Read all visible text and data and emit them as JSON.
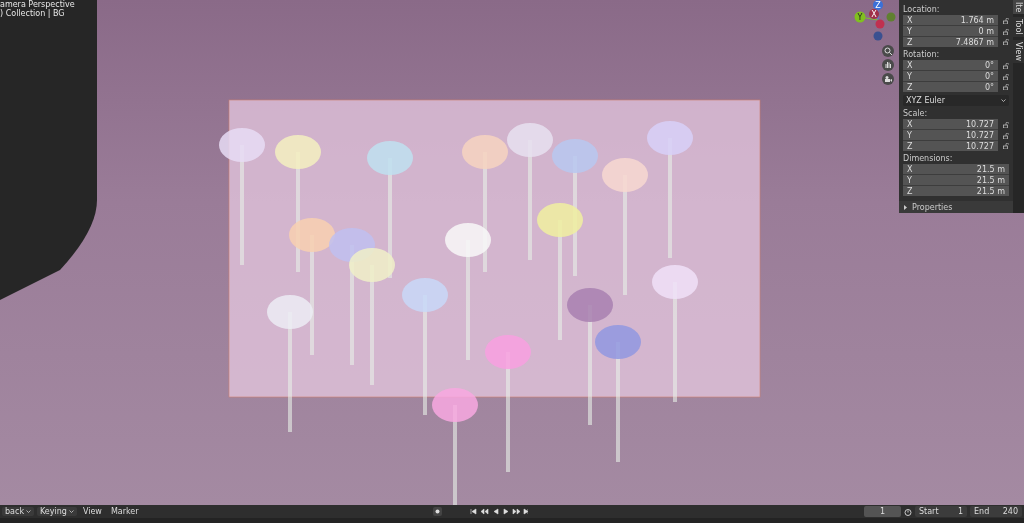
{
  "viewport": {
    "header_lines": [
      "amera Perspective",
      ") Collection | BG"
    ]
  },
  "gizmo": {
    "axes": [
      "Z",
      "Y",
      "X"
    ]
  },
  "sidebar": {
    "tabs": [
      {
        "label": "Ite",
        "selected": true
      },
      {
        "label": "Tool",
        "selected": false
      },
      {
        "label": "View",
        "selected": false
      }
    ],
    "sections": [
      {
        "kind": "vector",
        "title": "Location:",
        "rows": [
          {
            "axis": "X",
            "value": "1.764 m",
            "locked": false
          },
          {
            "axis": "Y",
            "value": "0 m",
            "locked": false
          },
          {
            "axis": "Z",
            "value": "7.4867 m",
            "locked": false
          }
        ]
      },
      {
        "kind": "vector",
        "title": "Rotation:",
        "rows": [
          {
            "axis": "X",
            "value": "0°",
            "locked": false
          },
          {
            "axis": "Y",
            "value": "0°",
            "locked": false
          },
          {
            "axis": "Z",
            "value": "0°",
            "locked": false
          }
        ]
      },
      {
        "kind": "select",
        "value": "XYZ Euler"
      },
      {
        "kind": "vector",
        "title": "Scale:",
        "rows": [
          {
            "axis": "X",
            "value": "10.727",
            "locked": false
          },
          {
            "axis": "Y",
            "value": "10.727",
            "locked": false
          },
          {
            "axis": "Z",
            "value": "10.727",
            "locked": false
          }
        ]
      },
      {
        "kind": "plain",
        "title": "Dimensions:",
        "rows": [
          {
            "axis": "X",
            "value": "21.5 m"
          },
          {
            "axis": "Y",
            "value": "21.5 m"
          },
          {
            "axis": "Z",
            "value": "21.5 m"
          }
        ]
      }
    ],
    "collapsed_panel": {
      "title": "Properties",
      "expanded": false
    }
  },
  "timeline": {
    "menus": [
      {
        "label": "back",
        "dropdown": true
      },
      {
        "label": "Keying",
        "dropdown": true
      },
      {
        "label": "View",
        "dropdown": false
      },
      {
        "label": "Marker",
        "dropdown": false
      }
    ],
    "current_frame": "1",
    "start_label": "Start",
    "start": "1",
    "end_label": "End",
    "end": "240"
  }
}
